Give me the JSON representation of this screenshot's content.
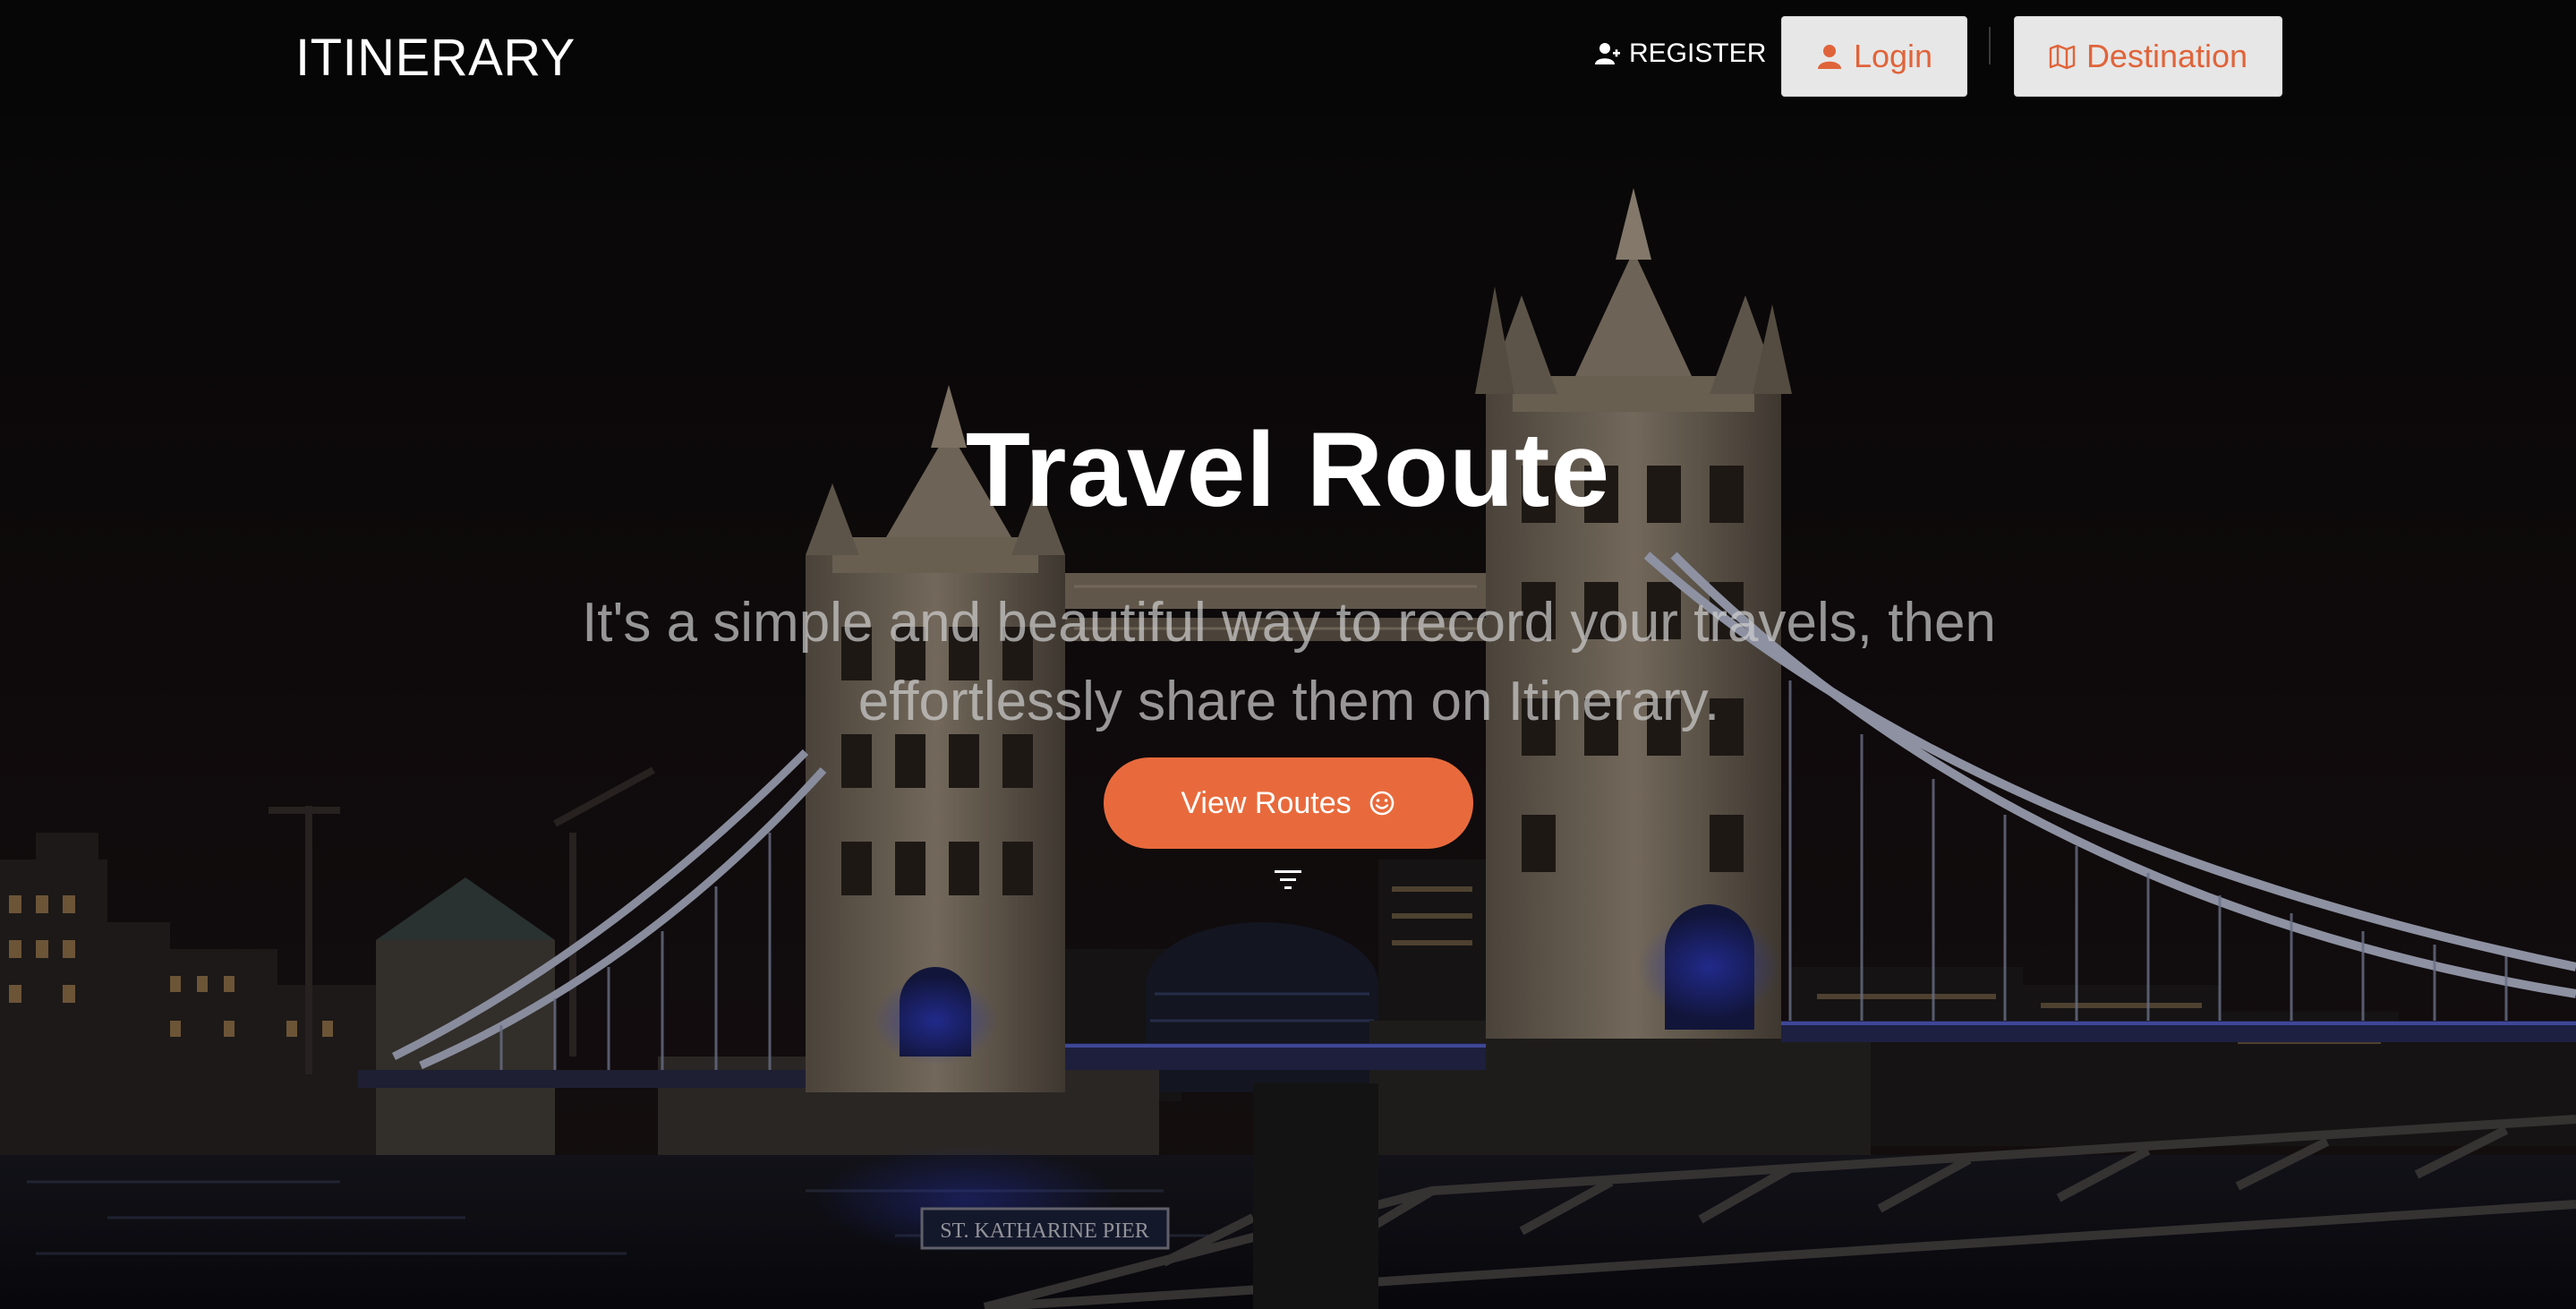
{
  "header": {
    "brand": "ITINERARY",
    "register_label": "REGISTER",
    "login_label": "Login",
    "destination_label": "Destination"
  },
  "hero": {
    "title": "Travel Route",
    "subtitle": "It's a simple and beautiful way to record your travels, then effortlessly share them on Itinerary.",
    "cta_label": "View Routes",
    "sign_text": "ST. KATHARINE PIER"
  },
  "icons": {
    "register": "user-plus-icon",
    "login": "user-icon",
    "destination": "map-icon",
    "cta": "smile-icon",
    "scroll": "filter-icon"
  },
  "colors": {
    "accent": "#e86a3c",
    "nav_button_bg": "#e7e7e7",
    "topbar_bg": "#060606"
  }
}
